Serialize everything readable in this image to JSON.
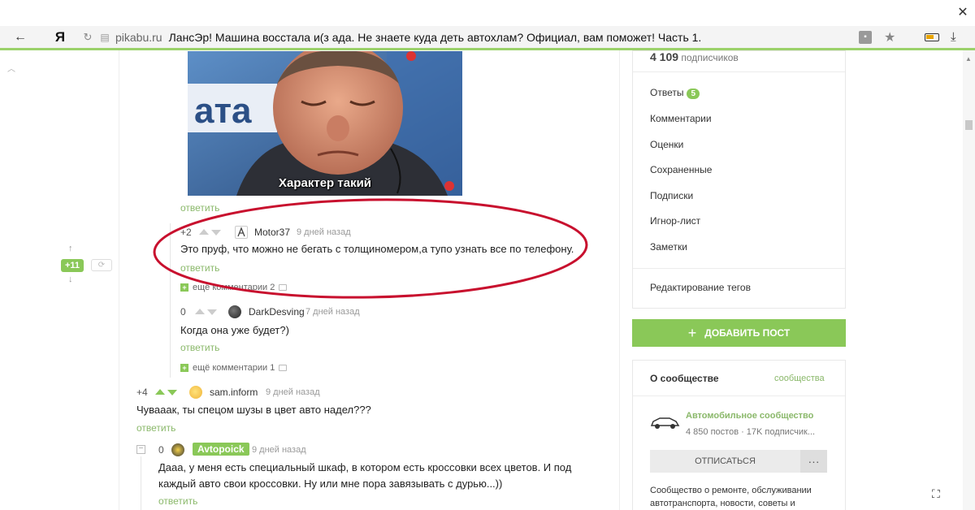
{
  "browser": {
    "ya_logo": "Я",
    "domain": "pikabu.ru",
    "title": "ЛансЭр! Машина восстала и(з ада. Не знаете куда деть автохлам? Официал, вам поможет! Часть 1."
  },
  "left_vote": {
    "rating": "+11"
  },
  "meme": {
    "caption": "Характер такий"
  },
  "comments": [
    {
      "reply_label": "ответить"
    },
    {
      "rating": "+2",
      "nick": "Motor37",
      "time": "9 дней назад",
      "text": "Это пруф, что можно не бегать с толщиномером,а тупо узнать все по телефону.",
      "reply_label": "ответить",
      "more_label": "ещё комментарии 2"
    },
    {
      "rating": "0",
      "nick": "DarkDesving",
      "time": "7 дней назад",
      "text": "Когда она уже будет?)",
      "reply_label": "ответить",
      "more_label": "ещё комментарии 1"
    },
    {
      "rating": "+4",
      "nick": "sam.inform",
      "time": "9 дней назад",
      "text": "Чуваaaк, ты спецом шузы в цвет авто надел???",
      "reply_label": "ответить"
    },
    {
      "rating": "0",
      "nick": "Avtopoick",
      "time": "9 дней назад",
      "text": "Дааа, у меня есть специальный шкаф, в котором есть кроссовки всех цветов. И под каждый авто свои кроссовки. Ну или мне пора завязывать с дурью...))",
      "reply_label": "ответить"
    }
  ],
  "sidebar": {
    "subscribers_count": "4 109",
    "subscribers_label": "подписчиков",
    "menu": [
      {
        "label": "Ответы",
        "badge": "5"
      },
      {
        "label": "Комментарии"
      },
      {
        "label": "Оценки"
      },
      {
        "label": "Сохраненные"
      },
      {
        "label": "Подписки"
      },
      {
        "label": "Игнор-лист"
      },
      {
        "label": "Заметки"
      }
    ],
    "edit_tags": "Редактирование тегов",
    "add_post": "ДОБАВИТЬ ПОСТ",
    "community": {
      "title": "О сообществе",
      "link": "сообщества",
      "name": "Автомобильное сообщество",
      "stats": "4 850 постов · 17K подписчик...",
      "unsubscribe": "ОТПИСАТЬСЯ",
      "more": "···",
      "description": "Сообщество о ремонте, обслуживании автотранспорта, новости, советы и"
    }
  },
  "colors": {
    "accent_green": "#8ac858",
    "link_green": "#8ab86a",
    "annotation_red": "#c8102e"
  }
}
